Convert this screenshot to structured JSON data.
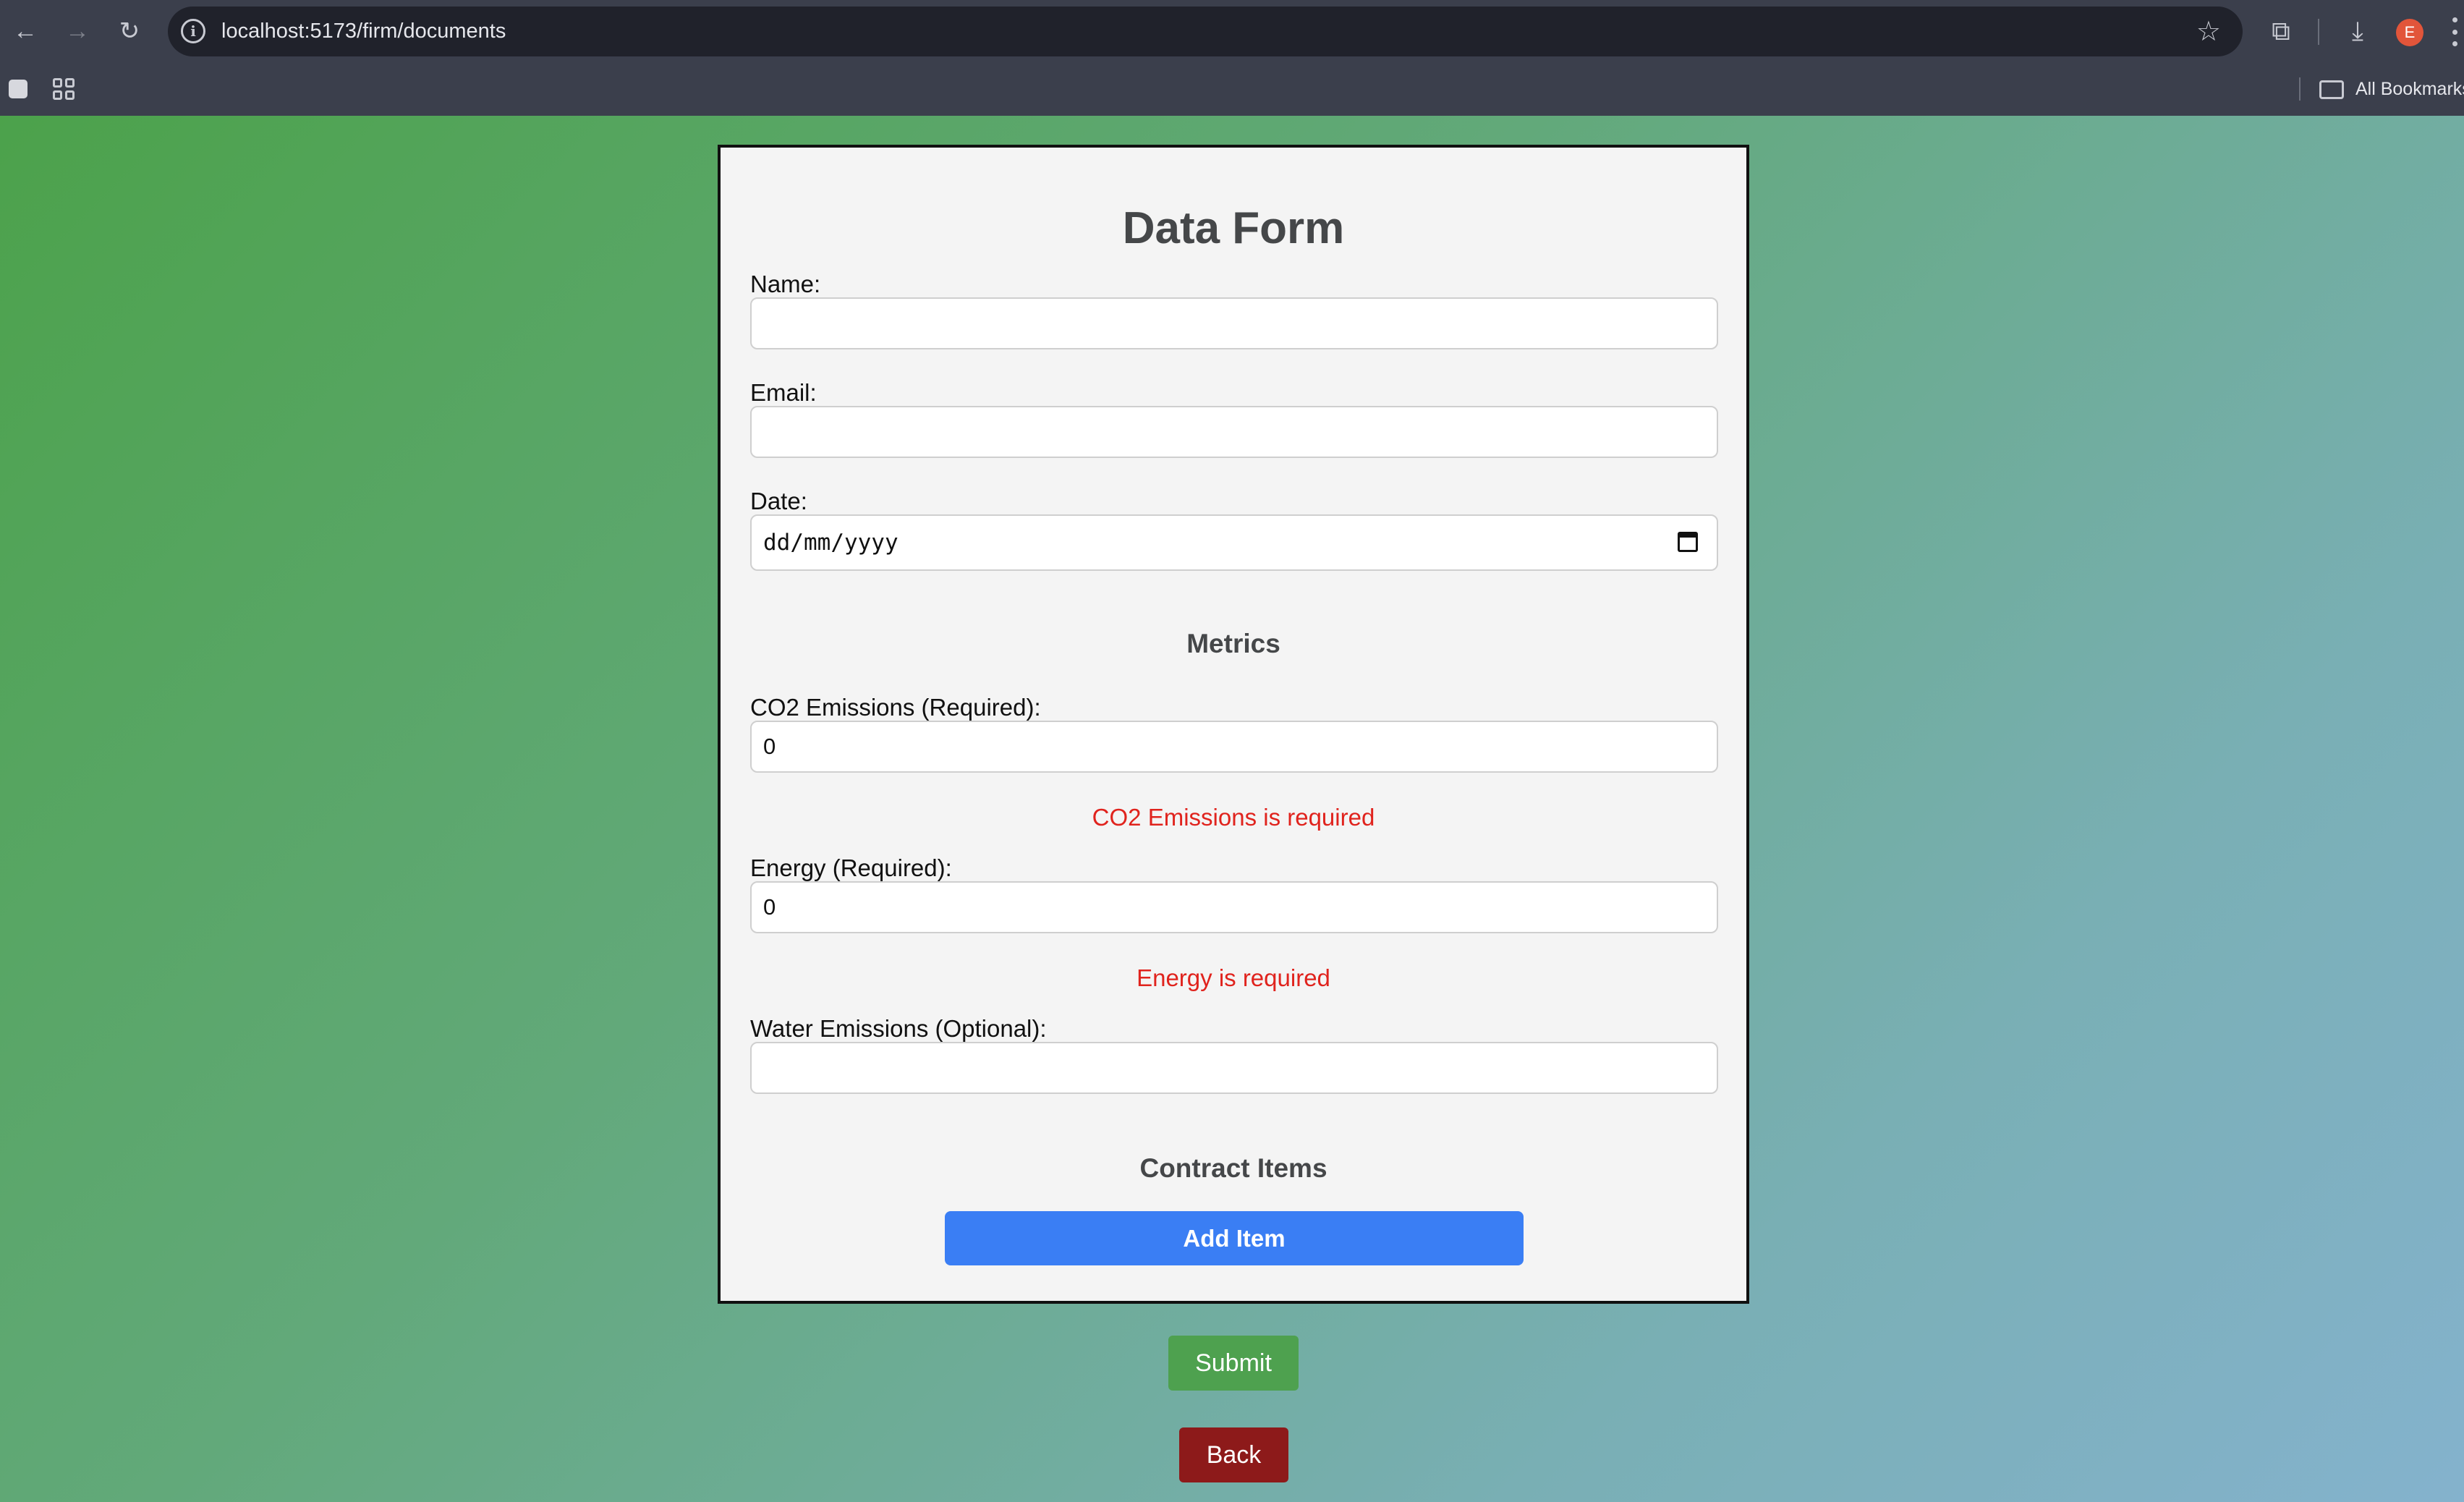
{
  "browser": {
    "url": "localhost:5173/firm/documents",
    "bookmarks_label": "All Bookmarks",
    "avatar_letter": "E"
  },
  "form": {
    "title": "Data Form",
    "name_label": "Name:",
    "name_value": "",
    "email_label": "Email:",
    "email_value": "",
    "date_label": "Date:",
    "date_placeholder": "dd/mm/yyyy",
    "metrics_heading": "Metrics",
    "co2_label": "CO2 Emissions (Required):",
    "co2_value": "0",
    "co2_error": "CO2 Emissions is required",
    "energy_label": "Energy (Required):",
    "energy_value": "0",
    "energy_error": "Energy is required",
    "water_label": "Water Emissions (Optional):",
    "water_value": "",
    "contract_heading": "Contract Items",
    "add_item_label": "Add Item"
  },
  "actions": {
    "submit_label": "Submit",
    "back_label": "Back"
  },
  "colors": {
    "error": "#e0231d",
    "primary_blue": "#3a7ef4",
    "submit_green": "#4ea14f",
    "back_red": "#8d1a1a"
  }
}
